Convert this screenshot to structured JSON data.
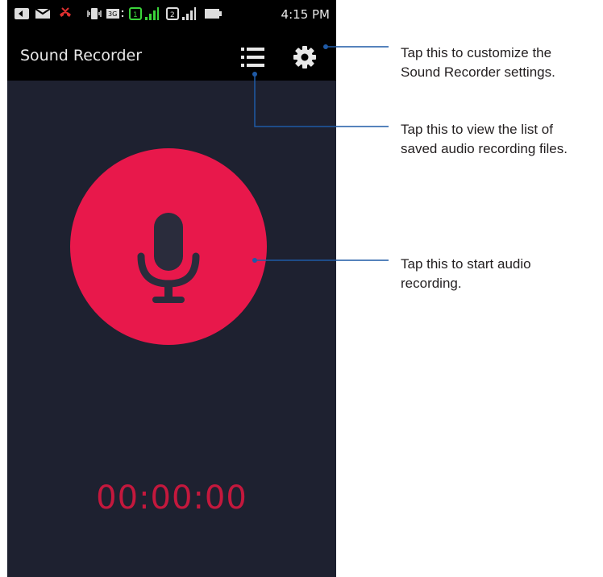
{
  "status_bar": {
    "time": "4:15 PM",
    "icons": [
      "back-icon",
      "mail-icon",
      "missed-call-icon",
      "vibrate-icon",
      "3g-icon",
      "sim1-icon",
      "signal-icon",
      "sim2-icon",
      "signal-icon",
      "battery-icon"
    ]
  },
  "app_bar": {
    "title": "Sound Recorder",
    "list_icon": "list-icon",
    "settings_icon": "gear-icon"
  },
  "main": {
    "record_icon": "microphone-icon",
    "timer": "00:00:00"
  },
  "callouts": {
    "settings": [
      "Tap this to customize the",
      "Sound Recorder settings."
    ],
    "list": [
      "Tap this to view the list of",
      "saved audio recording files."
    ],
    "record": [
      "Tap this to start audio",
      "recording."
    ]
  },
  "colors": {
    "record_button": "#e8184b",
    "timer": "#c4183d",
    "background": "#1e2130",
    "callout_line": "#1f5aa6"
  }
}
